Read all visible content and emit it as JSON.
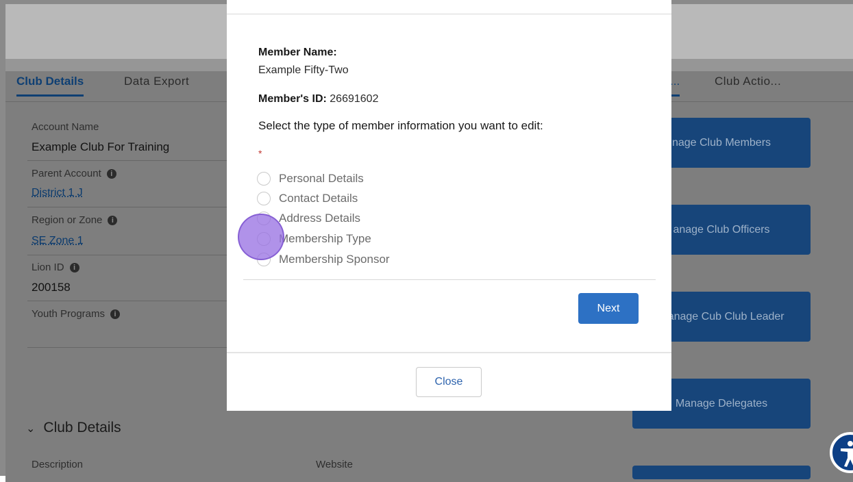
{
  "background": {
    "tabs_left": [
      "Club Details",
      "Data Export"
    ],
    "tabs_right": [
      "...",
      "Club Actio..."
    ],
    "fields": [
      {
        "label": "Account Name",
        "value": "Example Club For Training"
      },
      {
        "label": "Parent Account",
        "value": "District 1 J"
      },
      {
        "label": "Region or Zone",
        "value": "SE Zone 1"
      },
      {
        "label": "Lion ID",
        "value": "200158"
      },
      {
        "label": "Youth Programs",
        "value": ""
      }
    ],
    "section_title": "Club Details",
    "sub_labels": [
      "Description",
      "Website"
    ],
    "action_buttons": [
      "nage Club Members",
      "anage Club Officers",
      "Manage Cub Club Leader",
      "Manage Delegates"
    ]
  },
  "modal": {
    "member_name_label": "Member Name:",
    "member_name": "Example Fifty-Two",
    "member_id_label": "Member's ID:",
    "member_id": "26691602",
    "question": "Select the type of member information you want to edit:",
    "required_mark": "*",
    "options": [
      "Personal Details",
      "Contact Details",
      "Address Details",
      "Membership Type",
      "Membership Sponsor"
    ],
    "next_label": "Next",
    "close_label": "Close"
  },
  "colors": {
    "brand_blue": "#2d71c4",
    "overlay_gray": "#8a8a8a",
    "cursor": "#9a6ee1"
  }
}
